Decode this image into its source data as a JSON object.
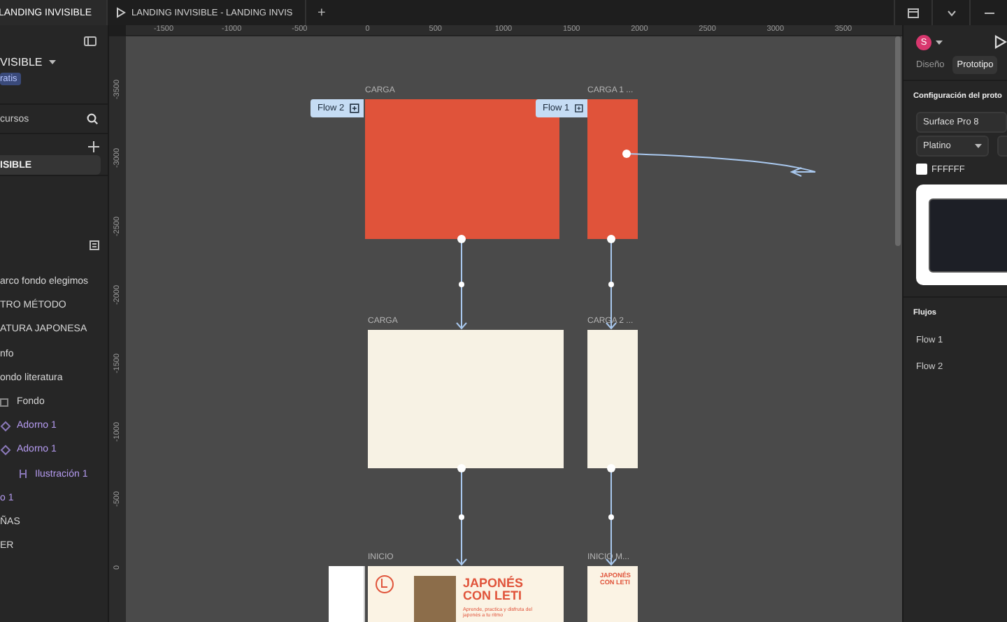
{
  "tabs": [
    {
      "label": "LANDING INVISIBLE",
      "kind": "file",
      "selected": true
    },
    {
      "label": "LANDING INVISIBLE - LANDING INVIS",
      "kind": "view",
      "selected": false
    }
  ],
  "new_tab": "+",
  "sidebar": {
    "project": "VISIBLE",
    "plan_badge": "ratis",
    "assets_label": "cursos",
    "pages": [
      {
        "name": "ISIBLE",
        "selected": true
      }
    ],
    "layers": [
      {
        "name": "arco fondo elegimos",
        "component": false
      },
      {
        "name": "TRO MÉTODO",
        "component": false
      },
      {
        "name": "ATURA JAPONESA",
        "component": false
      },
      {
        "name": "nfo",
        "component": false
      },
      {
        "name": "ondo literatura",
        "component": false,
        "children": [
          {
            "name": "Fondo",
            "kind": "rect",
            "component": false
          },
          {
            "name": "Adorno 1",
            "kind": "path",
            "component": true
          },
          {
            "name": "Adorno 1",
            "kind": "path",
            "component": true,
            "children": [
              {
                "name": "Ilustración 1",
                "kind": "frame",
                "component": true
              }
            ]
          }
        ]
      },
      {
        "name": "o 1",
        "component": true
      },
      {
        "name": "ÑAS",
        "component": false
      },
      {
        "name": "ER",
        "component": false
      }
    ]
  },
  "rulers": {
    "horizontal": [
      "-1500",
      "-1000",
      "-500",
      "0",
      "500",
      "1000",
      "1500",
      "2000",
      "2500",
      "3000",
      "3500"
    ],
    "vertical": [
      "-3500",
      "-3000",
      "-2500",
      "-2000",
      "-1500",
      "-1000",
      "-500",
      "0"
    ]
  },
  "boards": [
    {
      "label": "CARGA",
      "kind": "solid",
      "color": "#e0533a"
    },
    {
      "label": "CARGA 1 ...",
      "kind": "solid",
      "color": "#e0533a"
    },
    {
      "label": "CARGA",
      "kind": "solid",
      "color": "#f7f2e4"
    },
    {
      "label": "CARGA 2 ...",
      "kind": "solid",
      "color": "#f7f2e4"
    },
    {
      "label": "INICIO",
      "kind": "landing",
      "title": "JAPONÉS CON LETI",
      "subtitle": "Aprende, practica y disfruta del japonés a tu ritmo"
    },
    {
      "label": "INICIO M...",
      "kind": "landing_small",
      "title": "JAPONÉS CON LETI"
    }
  ],
  "flow_badges": [
    {
      "label": "Flow 2"
    },
    {
      "label": "Flow 1"
    }
  ],
  "right_panel": {
    "avatar": "S",
    "tabs": [
      {
        "label": "Diseño",
        "selected": false
      },
      {
        "label": "Prototipo",
        "selected": true
      }
    ],
    "config_title": "Configuración del proto",
    "device": "Surface Pro 8",
    "device_color": "Platino",
    "background_checked": false,
    "background_value": "FFFFFF",
    "flows_title": "Flujos",
    "flows": [
      "Flow 1",
      "Flow 2"
    ]
  }
}
